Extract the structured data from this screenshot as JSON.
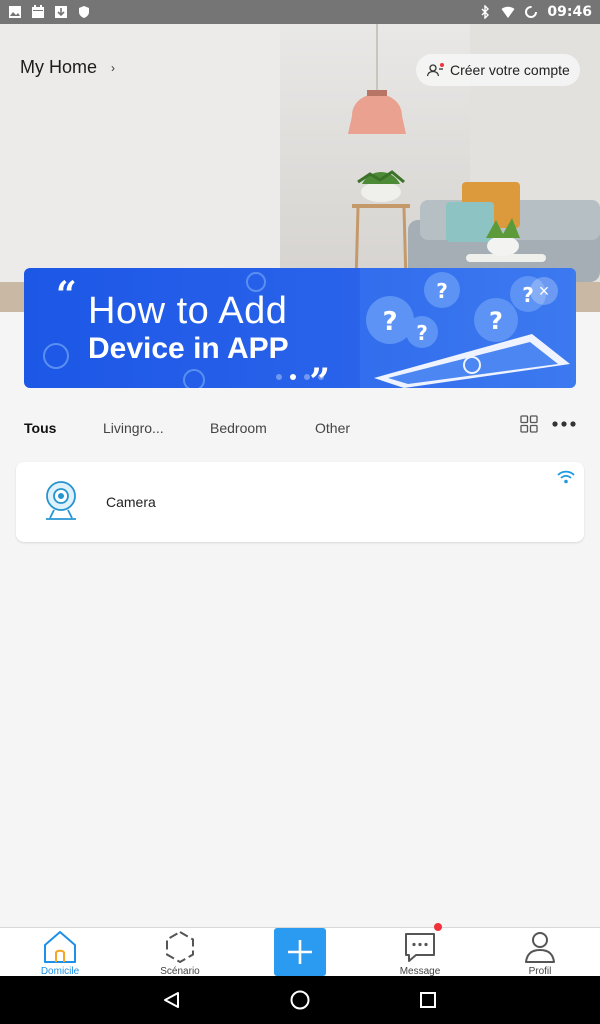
{
  "status_bar": {
    "time": "09:46",
    "left_icons": [
      "image-icon",
      "calendar-icon",
      "download-icon",
      "shield-icon"
    ],
    "right_icons": [
      "bluetooth-icon",
      "wifi-icon",
      "loading-icon"
    ]
  },
  "header": {
    "home_title": "My Home",
    "home_chevron": "›",
    "account_button": "Créer votre compte"
  },
  "banner": {
    "line1": "How to Add",
    "line2": "Device in APP",
    "quote_open": "“",
    "quote_close": "„",
    "close": "×",
    "dots_total": 4,
    "dots_active_index": 1
  },
  "tabs": [
    {
      "label": "Tous",
      "active": true
    },
    {
      "label": "Livingro...",
      "active": false
    },
    {
      "label": "Bedroom",
      "active": false
    },
    {
      "label": "Other",
      "active": false
    }
  ],
  "device": {
    "name": "Camera",
    "icon": "camera-icon",
    "status_icon": "wifi-icon"
  },
  "bottom_nav": {
    "items": [
      {
        "label": "Domicile",
        "icon": "home-icon",
        "active": true
      },
      {
        "label": "Scénario",
        "icon": "scenario-icon",
        "active": false
      },
      {
        "label": "Message",
        "icon": "message-icon",
        "active": false
      },
      {
        "label": "Profil",
        "icon": "profile-icon",
        "active": false
      }
    ],
    "add": "+"
  },
  "colors": {
    "accent": "#2a9bf0",
    "banner": "#1c57e6",
    "badge": "#f2323a"
  }
}
